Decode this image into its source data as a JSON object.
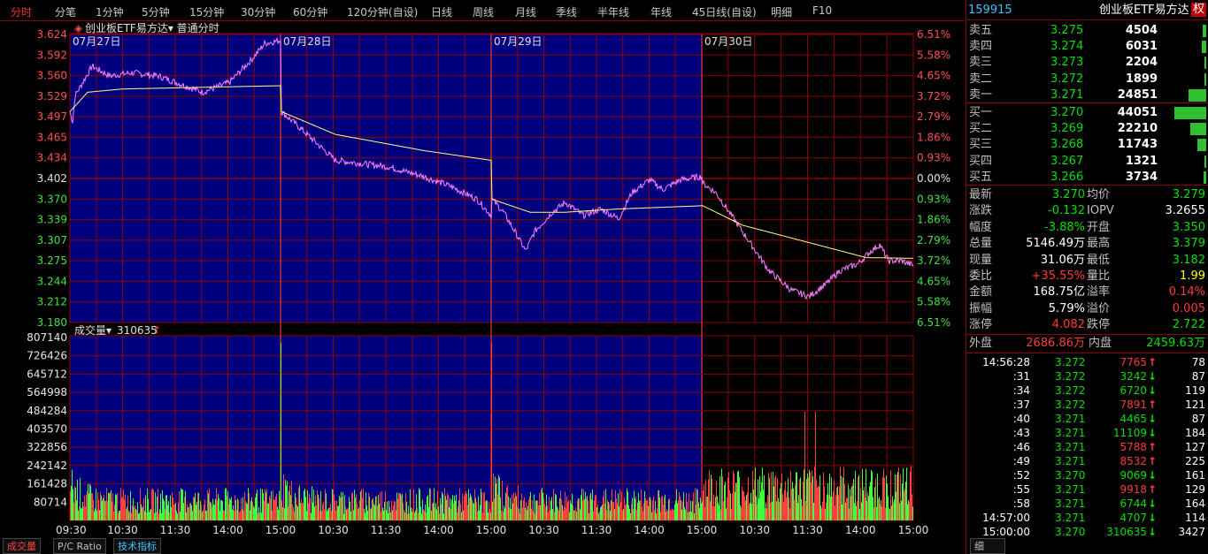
{
  "toolbar": {
    "tabs": [
      "分时",
      "分笔",
      "1分钟",
      "5分钟",
      "15分钟",
      "30分钟",
      "60分钟",
      "120分钟(自设)",
      "日线",
      "周线",
      "月线",
      "季线",
      "半年线",
      "年线",
      "45日线(自设)",
      "明细",
      "F10"
    ],
    "active": "分时"
  },
  "chart": {
    "title_icon": "diamond-icon",
    "security_name": "创业板ETF易方达",
    "mode": "普通分时",
    "day_labels": [
      "07月27日",
      "07月28日",
      "07月29日",
      "07月30日"
    ],
    "price_ticks": [
      "3.624",
      "3.592",
      "3.560",
      "3.529",
      "3.497",
      "3.465",
      "3.434",
      "3.402",
      "3.370",
      "3.339",
      "3.307",
      "3.275",
      "3.244",
      "3.212",
      "3.180"
    ],
    "pct_ticks": [
      "6.51%",
      "5.58%",
      "4.65%",
      "3.72%",
      "2.79%",
      "1.86%",
      "0.93%",
      "0.00%",
      "0.93%",
      "1.86%",
      "2.79%",
      "3.72%",
      "4.65%",
      "5.58%",
      "6.51%"
    ],
    "volume_label": "成交量",
    "volume_value": "310635",
    "volume_ticks": [
      "807140",
      "726426",
      "645712",
      "564998",
      "484284",
      "403570",
      "322856",
      "242142",
      "161428",
      "80714"
    ],
    "time_labels": [
      "09:30",
      "10:30",
      "11:30",
      "14:00",
      "15:00",
      "10:30",
      "11:30",
      "14:00",
      "15:00",
      "10:30",
      "11:30",
      "14:00",
      "15:00",
      "10:30",
      "11:30",
      "14:00",
      "15:00"
    ],
    "colors": {
      "panel_blue": "#00007f",
      "grid_red": "#8b0000",
      "price_line": "#ff80ff",
      "avg_line": "#ffff80",
      "up": "#ff4040",
      "down": "#40ff40"
    }
  },
  "bottom_tabs": [
    "成交量",
    "P/C Ratio",
    "技术指标"
  ],
  "quote": {
    "code": "159915",
    "name": "创业板ETF易方达",
    "badge": "权",
    "asks": [
      {
        "label": "卖五",
        "price": "3.275",
        "vol": "4504",
        "bar": 0.09
      },
      {
        "label": "卖四",
        "price": "3.274",
        "vol": "6031",
        "bar": 0.12
      },
      {
        "label": "卖三",
        "price": "3.273",
        "vol": "2204",
        "bar": 0.04
      },
      {
        "label": "卖二",
        "price": "3.272",
        "vol": "1899",
        "bar": 0.04
      },
      {
        "label": "卖一",
        "price": "3.271",
        "vol": "24851",
        "bar": 0.5
      }
    ],
    "bids": [
      {
        "label": "买一",
        "price": "3.270",
        "vol": "44051",
        "bar": 0.9
      },
      {
        "label": "买二",
        "price": "3.269",
        "vol": "22210",
        "bar": 0.45
      },
      {
        "label": "买三",
        "price": "3.268",
        "vol": "11743",
        "bar": 0.24
      },
      {
        "label": "买四",
        "price": "3.267",
        "vol": "1321",
        "bar": 0.03
      },
      {
        "label": "买五",
        "price": "3.266",
        "vol": "3734",
        "bar": 0.08
      }
    ],
    "stats": [
      {
        "l1": "最新",
        "v1": "3.270",
        "c1": "g",
        "l2": "均价",
        "v2": "3.279",
        "c2": "g"
      },
      {
        "l1": "涨跌",
        "v1": "-0.132",
        "c1": "g",
        "l2": "IOPV",
        "v2": "3.2655",
        "c2": "w"
      },
      {
        "l1": "幅度",
        "v1": "-3.88%",
        "c1": "g",
        "l2": "开盘",
        "v2": "3.350",
        "c2": "g"
      },
      {
        "l1": "总量",
        "v1": "5146.49万",
        "c1": "w",
        "l2": "最高",
        "v2": "3.379",
        "c2": "g"
      },
      {
        "l1": "现量",
        "v1": "31.06万",
        "c1": "w",
        "l2": "最低",
        "v2": "3.182",
        "c2": "g"
      },
      {
        "l1": "委比",
        "v1": "+35.55%",
        "c1": "r",
        "l2": "量比",
        "v2": "1.99",
        "c2": "y"
      },
      {
        "l1": "金额",
        "v1": "168.75亿",
        "c1": "w",
        "l2": "溢率",
        "v2": "0.14%",
        "c2": "r"
      },
      {
        "l1": "振幅",
        "v1": "5.79%",
        "c1": "w",
        "l2": "溢价",
        "v2": "0.005",
        "c2": "r"
      },
      {
        "l1": "涨停",
        "v1": "4.082",
        "c1": "r",
        "l2": "跌停",
        "v2": "2.722",
        "c2": "g"
      }
    ],
    "outer": {
      "label": "外盘",
      "value": "2686.86万"
    },
    "inner": {
      "label": "内盘",
      "value": "2459.63万"
    },
    "ticks": [
      {
        "t": "14:56:28",
        "p": "3.272",
        "v": "7765",
        "d": "up",
        "n": "78"
      },
      {
        "t": ":31",
        "p": "3.272",
        "v": "3242",
        "d": "down",
        "n": "87"
      },
      {
        "t": ":34",
        "p": "3.272",
        "v": "6720",
        "d": "down",
        "n": "119"
      },
      {
        "t": ":37",
        "p": "3.272",
        "v": "7891",
        "d": "up",
        "n": "121"
      },
      {
        "t": ":40",
        "p": "3.271",
        "v": "4465",
        "d": "down",
        "n": "87"
      },
      {
        "t": ":43",
        "p": "3.271",
        "v": "11109",
        "d": "down",
        "n": "184"
      },
      {
        "t": ":46",
        "p": "3.271",
        "v": "5788",
        "d": "up",
        "n": "127"
      },
      {
        "t": ":49",
        "p": "3.271",
        "v": "8532",
        "d": "up",
        "n": "225"
      },
      {
        "t": ":52",
        "p": "3.270",
        "v": "9069",
        "d": "down",
        "n": "161"
      },
      {
        "t": ":55",
        "p": "3.271",
        "v": "9918",
        "d": "up",
        "n": "129"
      },
      {
        "t": ":58",
        "p": "3.271",
        "v": "6744",
        "d": "down",
        "n": "164"
      },
      {
        "t": "14:57:00",
        "p": "3.271",
        "v": "4707",
        "d": "down",
        "n": "114"
      },
      {
        "t": "15:00:00",
        "p": "3.270",
        "v": "310635",
        "d": "down",
        "n": "3427"
      }
    ],
    "footer_tab": "细"
  }
}
